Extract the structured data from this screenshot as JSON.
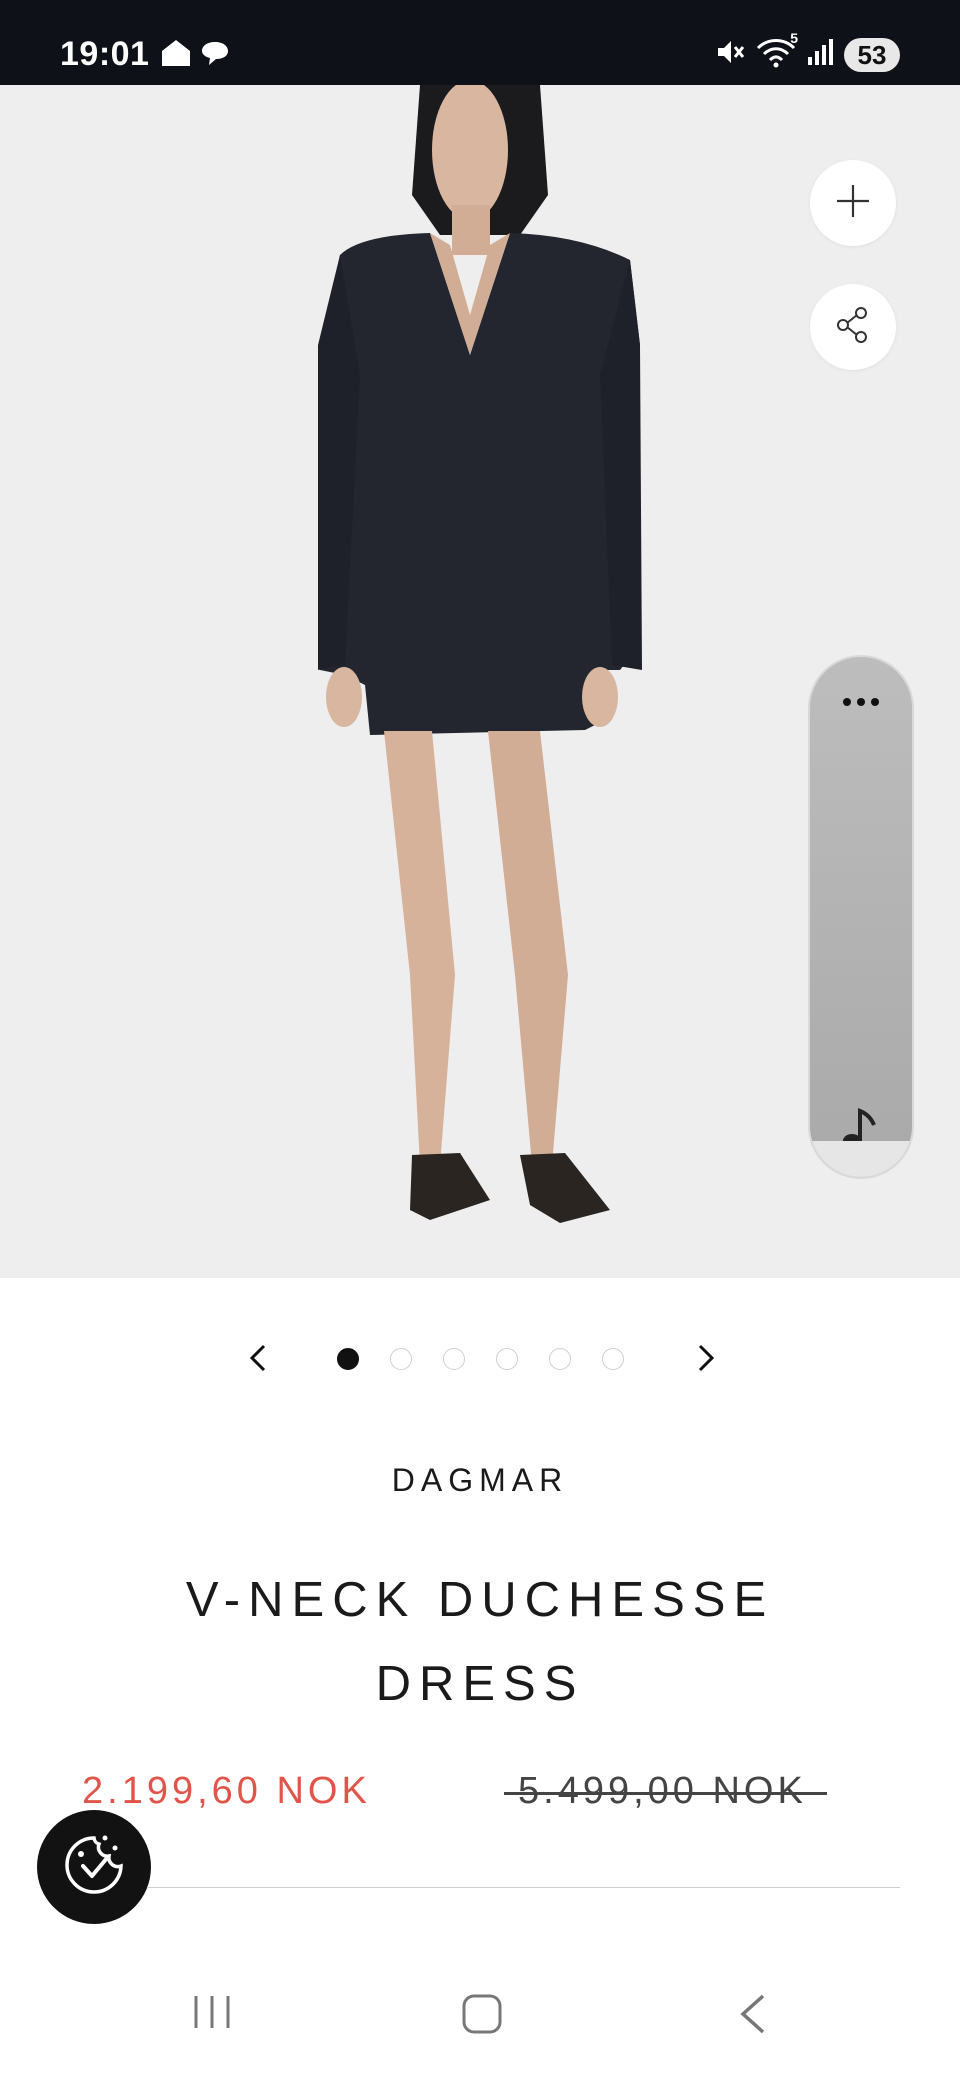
{
  "status_bar": {
    "time": "19:01",
    "battery": "53",
    "left_icons": [
      "home-icon",
      "chat-bubble-icon"
    ],
    "right_icons": [
      "mute-icon",
      "wifi-icon",
      "signal-icon"
    ],
    "wifi_label": "5"
  },
  "product": {
    "brand": "DAGMAR",
    "title": "V-NECK DUCHESSE DRESS",
    "sale_price": "2.199,60 NOK",
    "original_price": "5.499,00 NOK"
  },
  "gallery": {
    "image_count": 6,
    "active_index": 0
  },
  "side_panel": {
    "icons": [
      "more-icon",
      "music-note-icon"
    ]
  },
  "colors": {
    "sale_price": "#e0544a",
    "status_bar_bg": "#0f1118",
    "text": "#1a1a1a",
    "cookie_button_bg": "#121212"
  },
  "navigation": {
    "items": [
      "recents-icon",
      "home-icon",
      "back-icon"
    ]
  }
}
